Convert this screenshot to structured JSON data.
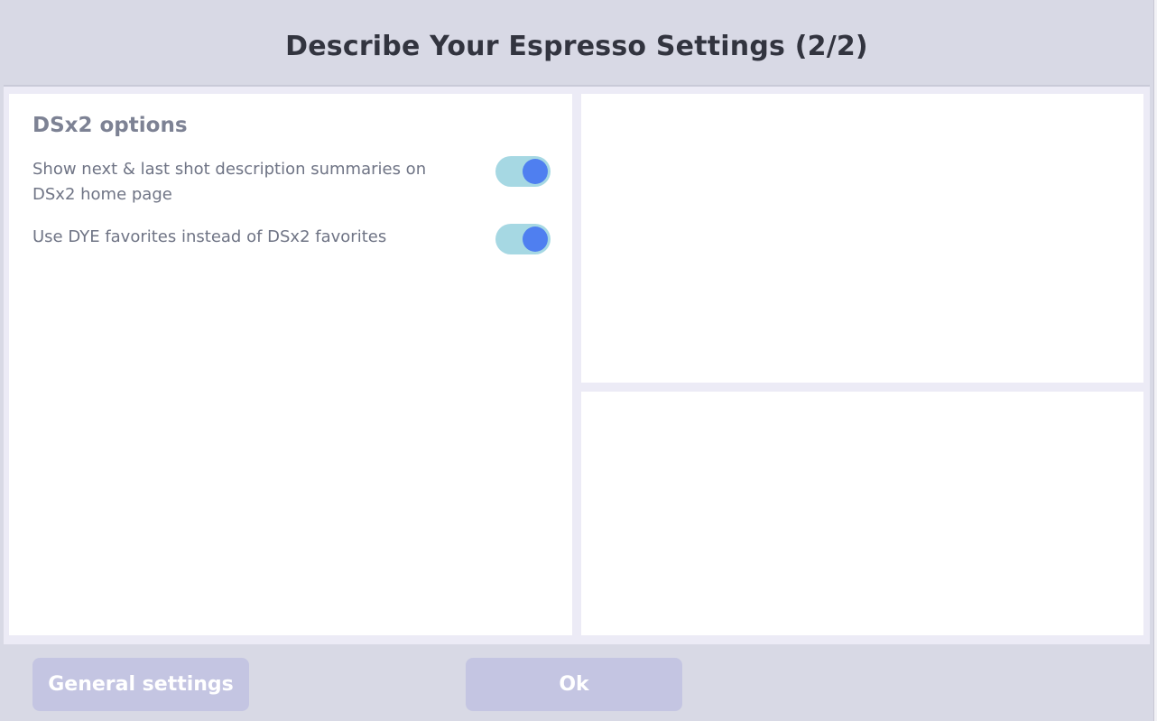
{
  "header": {
    "title": "Describe Your Espresso Settings (2/2)"
  },
  "left_panel": {
    "section_title": "DSx2 options",
    "options": [
      {
        "label": "Show next & last shot description summaries on DSx2 home page",
        "enabled": true
      },
      {
        "label": "Use DYE favorites instead of DSx2 favorites",
        "enabled": true
      }
    ]
  },
  "footer": {
    "general_settings_label": "General settings",
    "ok_label": "Ok"
  },
  "colors": {
    "background": "#d8d9e5",
    "panel": "#ffffff",
    "toggle_track_on": "#a6d8e3",
    "toggle_knob_on": "#4f7ff0",
    "button_bg": "#c4c5e2",
    "title_text": "#32343f"
  }
}
